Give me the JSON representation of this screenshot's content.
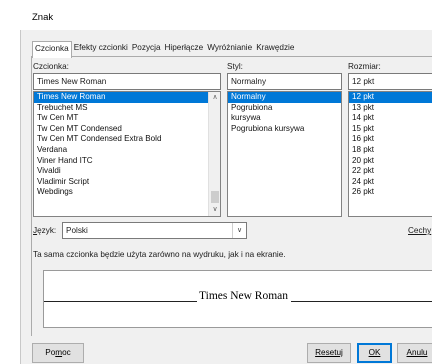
{
  "dialog": {
    "title": "Znak"
  },
  "tabs": [
    {
      "label": "Czcionka",
      "active": true
    },
    {
      "label": "Efekty czcionki"
    },
    {
      "label": "Pozycja"
    },
    {
      "label": "Hiperłącze"
    },
    {
      "label": "Wyróżnianie"
    },
    {
      "label": "Krawędzie"
    }
  ],
  "font": {
    "label": "Czcionka:",
    "value": "Times New Roman",
    "items": [
      "Times New Roman",
      "Trebuchet MS",
      "Tw Cen MT",
      "Tw Cen MT Condensed",
      "Tw Cen MT Condensed Extra Bold",
      "Verdana",
      "Viner Hand ITC",
      "Vivaldi",
      "Vladimir Script",
      "Webdings"
    ]
  },
  "style": {
    "label": "Styl:",
    "value": "Normalny",
    "items": [
      "Normalny",
      "Pogrubiona",
      "kursywa",
      "Pogrubiona kursywa"
    ]
  },
  "size": {
    "label": "Rozmiar:",
    "value": "12 pkt",
    "items": [
      "12 pkt",
      "13 pkt",
      "14 pkt",
      "15 pkt",
      "16 pkt",
      "18 pkt",
      "20 pkt",
      "22 pkt",
      "24 pkt",
      "26 pkt"
    ]
  },
  "language": {
    "label_prefix": "J",
    "label_rest": "ęzyk:",
    "value": "Polski",
    "features_button": "Cechy"
  },
  "info_text": "Ta sama czcionka będzie użyta zarówno na wydruku, jak i na ekranie.",
  "preview": {
    "text": "Times New Roman"
  },
  "buttons": {
    "help_prefix": "Po",
    "help_u": "m",
    "help_rest": "oc",
    "reset_prefix": "",
    "reset": "Resetuj",
    "ok": "OK",
    "cancel": "Anulu"
  },
  "colors": {
    "selection": "#0078d7",
    "dialog_bg": "#f0f0f0"
  }
}
